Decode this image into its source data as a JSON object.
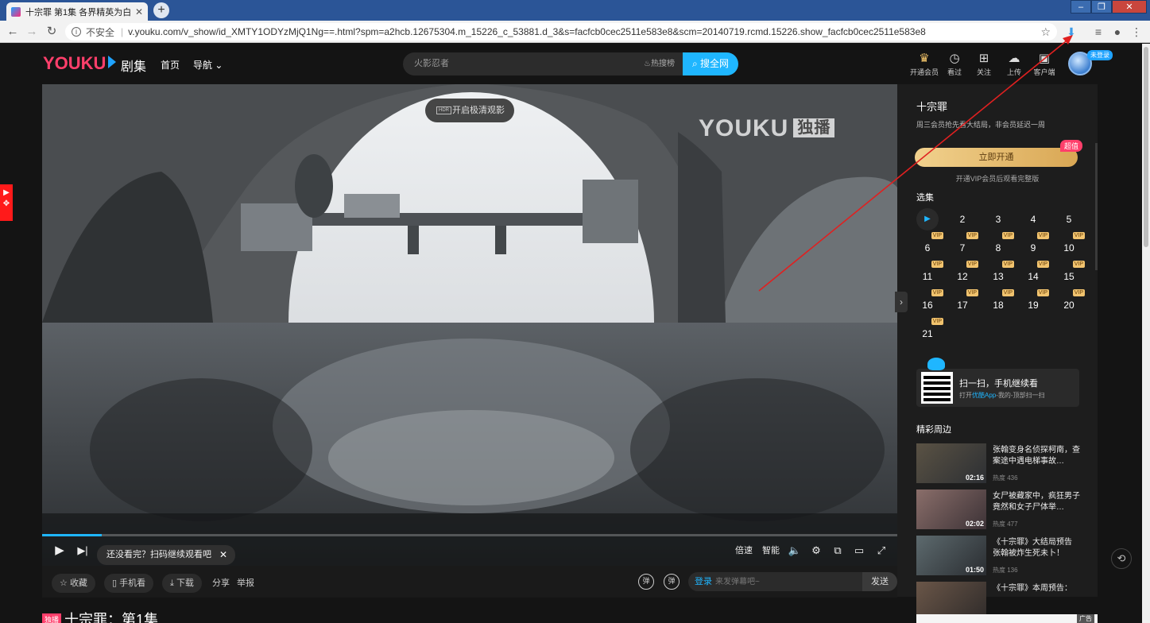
{
  "browser": {
    "tab_title": "十宗罪 第1集 各界精英为白骨案",
    "tab_close": "✕",
    "new_tab": "+",
    "insecure_label": "不安全",
    "url": "v.youku.com/v_show/id_XMTY1ODYzMjQ1Ng==.html?spm=a2hcb.12675304.m_15226_c_53881.d_3&s=facfcb0cec2511e583e8&scm=20140719.rcmd.15226.show_facfcb0cec2511e583e8"
  },
  "header": {
    "logo": "YOUKU",
    "channel": "剧集",
    "nav_home": "首页",
    "nav_guide": "导航",
    "search_value": "火影忍者",
    "search_hot": "热搜榜",
    "search_button": "搜全网",
    "icons": [
      {
        "label": "开通会员",
        "icon": "crown-icon"
      },
      {
        "label": "看过",
        "icon": "clock-icon"
      },
      {
        "label": "关注",
        "icon": "bookmark-icon"
      },
      {
        "label": "上传",
        "icon": "upload-icon"
      },
      {
        "label": "客户端",
        "icon": "client-icon"
      }
    ],
    "login_badge": "未登录"
  },
  "player": {
    "hdr_tag": "HDR",
    "hdr_label": "开启极清观影",
    "watermark": "YOUKU",
    "watermark_tag": "独播",
    "progress": 0.07,
    "tip": "还没看完？扫码继续观看吧",
    "tip_close": "✕",
    "controls": {
      "speed": "倍速",
      "quality": "智能"
    }
  },
  "actions": {
    "collect": "收藏",
    "phone": "手机看",
    "download": "下载",
    "share": "分享",
    "report": "举报",
    "danmu_login": "登录",
    "danmu_placeholder": "来发弹幕吧~",
    "send": "发送",
    "danmu_toggle": "弹",
    "danmu_settings": "弹"
  },
  "title": {
    "badge": "独播",
    "text": "十宗罪：第1集"
  },
  "side": {
    "show_title": "十宗罪",
    "note": "周三会员抢先看大结局，非会员延迟一周",
    "vip_button": "立即开通",
    "vip_tag": "超值",
    "vip_sub": "开通VIP会员后观看完整版",
    "episodes_label": "选集",
    "vip_mark": "VIP",
    "episodes": [
      {
        "num": "",
        "current": true,
        "vip": false
      },
      {
        "num": "2",
        "vip": false
      },
      {
        "num": "3",
        "vip": false
      },
      {
        "num": "4",
        "vip": false
      },
      {
        "num": "5",
        "vip": false
      },
      {
        "num": "6",
        "vip": true
      },
      {
        "num": "7",
        "vip": true
      },
      {
        "num": "8",
        "vip": true
      },
      {
        "num": "9",
        "vip": true
      },
      {
        "num": "10",
        "vip": true
      },
      {
        "num": "11",
        "vip": true
      },
      {
        "num": "12",
        "vip": true
      },
      {
        "num": "13",
        "vip": true
      },
      {
        "num": "14",
        "vip": true
      },
      {
        "num": "15",
        "vip": true
      },
      {
        "num": "16",
        "vip": true
      },
      {
        "num": "17",
        "vip": true
      },
      {
        "num": "18",
        "vip": true
      },
      {
        "num": "19",
        "vip": true
      },
      {
        "num": "20",
        "vip": true
      },
      {
        "num": "21",
        "vip": true
      }
    ],
    "qr_title": "扫一扫，手机继续看",
    "qr_sub_prefix": "打开",
    "qr_sub_app": "优酷App",
    "qr_sub_suffix": "-我的-顶部扫一扫",
    "related_label": "精彩周边",
    "related": [
      {
        "title": "张翰变身名侦探柯南，查案途中遇电梯事故…",
        "duration": "02:16",
        "hot": "热度 436"
      },
      {
        "title": "女尸被藏家中，疯狂男子竟然和女子尸体举…",
        "duration": "02:02",
        "hot": "热度 477"
      },
      {
        "title": "《十宗罪》大结局预告 张翰被炸生死未卜！",
        "duration": "01:50",
        "hot": "热度 136"
      },
      {
        "title": "《十宗罪》本周预告：",
        "duration": "",
        "hot": ""
      }
    ],
    "ad_tag": "广告"
  },
  "colors": {
    "brand_pink": "#ff3f6b",
    "brand_blue": "#1fb6ff",
    "vip_gold": "#e3b566",
    "annotation_red": "#e02020"
  }
}
